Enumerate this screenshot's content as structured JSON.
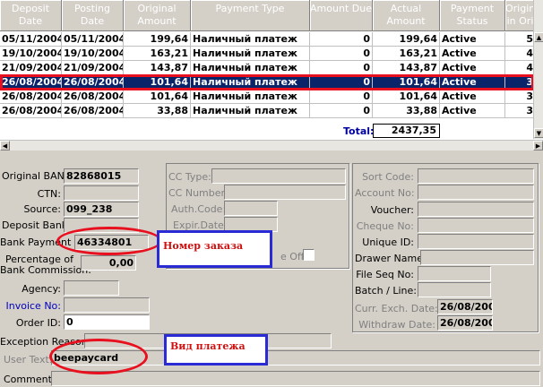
{
  "grid": {
    "columns": [
      "Deposit Date",
      "Posting Date",
      "Original Amount",
      "Payment Type",
      "Amount Due",
      "Actual Amount",
      "Payment Status",
      "Origin in Ori"
    ],
    "rows": [
      {
        "deposit": "05/11/2004",
        "posting": "05/11/2004",
        "original": "199,64",
        "type": "Наличный платеж",
        "due": "0",
        "actual": "199,64",
        "status": "Active",
        "origin": "5"
      },
      {
        "deposit": "19/10/2004",
        "posting": "19/10/2004",
        "original": "163,21",
        "type": "Наличный платеж",
        "due": "0",
        "actual": "163,21",
        "status": "Active",
        "origin": "4"
      },
      {
        "deposit": "21/09/2004",
        "posting": "21/09/2004",
        "original": "143,87",
        "type": "Наличный платеж",
        "due": "0",
        "actual": "143,87",
        "status": "Active",
        "origin": "4"
      },
      {
        "deposit": "26/08/2004",
        "posting": "26/08/2004",
        "original": "101,64",
        "type": "Наличный платеж",
        "due": "0",
        "actual": "101,64",
        "status": "Active",
        "origin": "3"
      },
      {
        "deposit": "26/08/2004",
        "posting": "26/08/2004",
        "original": "101,64",
        "type": "Наличный платеж",
        "due": "0",
        "actual": "101,64",
        "status": "Active",
        "origin": "3"
      },
      {
        "deposit": "26/08/2004",
        "posting": "26/08/2004",
        "original": "33,88",
        "type": "Наличный платеж",
        "due": "0",
        "actual": "33,88",
        "status": "Active",
        "origin": "3"
      }
    ],
    "selected_row": 3,
    "total_label": "Total:",
    "total_value": "2437,35"
  },
  "left": {
    "original_ban_label": "Original BAN:",
    "original_ban": "82868015",
    "ctn_label": "CTN:",
    "ctn": "",
    "source_label": "Source:",
    "source": "099_238",
    "deposit_bank_label": "Deposit Bank:",
    "deposit_bank": "",
    "bank_payment_id_label": "Bank Payment Id:",
    "bank_payment_id": "46334801",
    "pct_label_1": "Percentage of",
    "pct_label_2": "Bank Commission:",
    "pct": "0,00",
    "agency_label": "Agency:",
    "agency": "",
    "invoice_label": "Invoice No:",
    "invoice": "",
    "order_label": "Order ID:",
    "order": "0"
  },
  "middle": {
    "cc_type_label": "CC Type:",
    "cc_number_label": "CC Number:",
    "auth_code_label": "Auth.Code:",
    "expir_date_label": "Expir.Date:",
    "write_off_label": "e Off:"
  },
  "right": {
    "sort_code_label": "Sort Code:",
    "account_no_label": "Account No:",
    "voucher_label": "Voucher:",
    "cheque_no_label": "Cheque No:",
    "unique_id_label": "Unique ID:",
    "drawer_name_label": "Drawer Name:",
    "file_seq_label": "File Seq No:",
    "batch_line_label": "Batch / Line:",
    "curr_exch_label": "Curr. Exch. Date:",
    "curr_exch": "26/08/2004",
    "withdraw_label": "Withdraw Date:",
    "withdraw": "26/08/2004"
  },
  "bottom": {
    "exception_label": "Exception Reason:",
    "user_text_label": "User Text:",
    "user_text": "beepaycard",
    "comment_label": "Comment:"
  },
  "annotations": {
    "order_number": "Номер заказа",
    "payment_type": "Вид платежа"
  },
  "colors": {
    "selection": "#0a246a",
    "highlight_red": "#e8101e",
    "annotation_border": "#2b2bd6",
    "annotation_text": "#d01010",
    "link": "#0000c0"
  }
}
